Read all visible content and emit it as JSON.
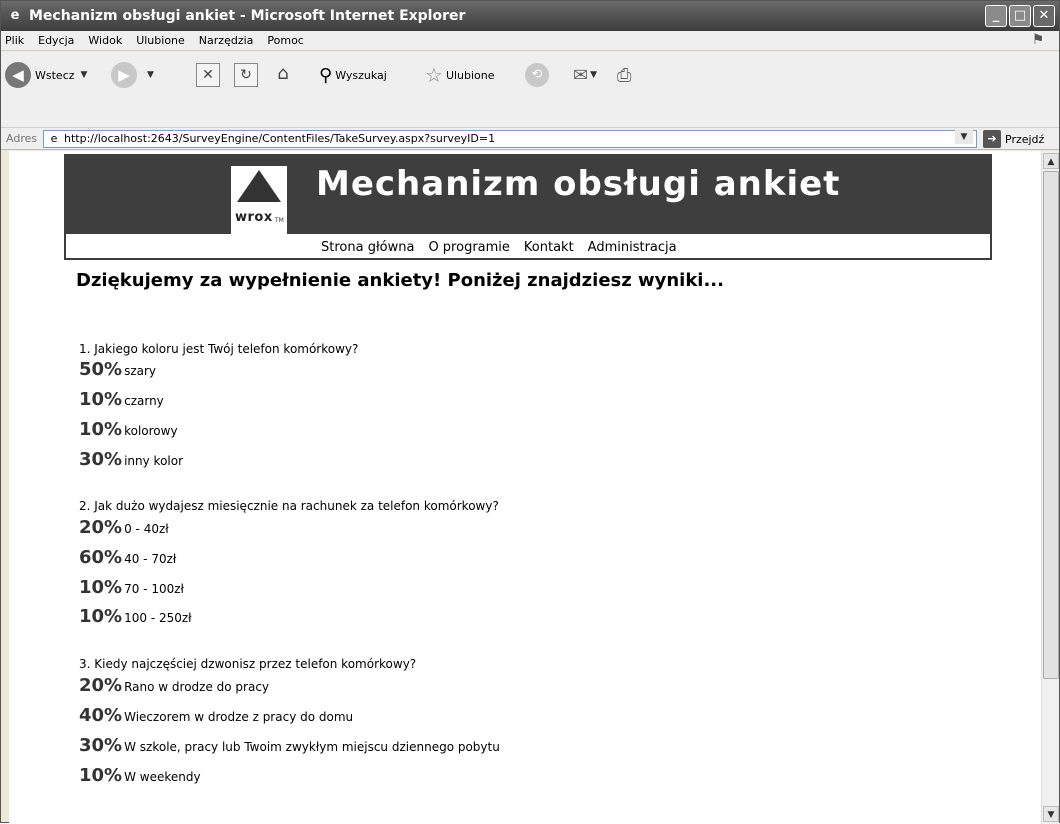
{
  "window": {
    "title": "Mechanizm obsługi ankiet - Microsoft Internet Explorer"
  },
  "menu": [
    "Plik",
    "Edycja",
    "Widok",
    "Ulubione",
    "Narzędzia",
    "Pomoc"
  ],
  "toolbar": {
    "back_label": "Wstecz",
    "search_label": "Wyszukaj",
    "favorites_label": "Ulubione"
  },
  "address": {
    "label": "Adres",
    "url": "http://localhost:2643/SurveyEngine/ContentFiles/TakeSurvey.aspx?surveyID=1",
    "go_label": "Przejdź"
  },
  "site": {
    "title": "Mechanizm obsługi ankiet",
    "logo_text": "wrox",
    "logo_tm": "TM",
    "nav": [
      "Strona główna",
      "O programie",
      "Kontakt",
      "Administracja"
    ]
  },
  "results": {
    "heading": "Dziękujemy za wypełnienie ankiety! Poniżej znajdziesz wyniki...",
    "questions": [
      {
        "text": "1. Jakiego koloru jest Twój telefon komórkowy?",
        "answers": [
          {
            "pct": "50%",
            "label": "szary"
          },
          {
            "pct": "10%",
            "label": "czarny"
          },
          {
            "pct": "10%",
            "label": "kolorowy"
          },
          {
            "pct": "30%",
            "label": "inny kolor"
          }
        ]
      },
      {
        "text": "2. Jak dużo wydajesz miesięcznie na rachunek za telefon komórkowy?",
        "answers": [
          {
            "pct": "20%",
            "label": "0 - 40zł"
          },
          {
            "pct": "60%",
            "label": "40 - 70zł"
          },
          {
            "pct": "10%",
            "label": "70 - 100zł"
          },
          {
            "pct": "10%",
            "label": "100 - 250zł"
          }
        ]
      },
      {
        "text": "3. Kiedy najczęściej dzwonisz przez telefon komórkowy?",
        "answers": [
          {
            "pct": "20%",
            "label": "Rano w drodze do pracy"
          },
          {
            "pct": "40%",
            "label": "Wieczorem w drodze z pracy do domu"
          },
          {
            "pct": "30%",
            "label": "W szkole, pracy lub Twoim zwykłym miejscu dziennego pobytu"
          },
          {
            "pct": "10%",
            "label": "W weekendy"
          }
        ]
      }
    ]
  }
}
